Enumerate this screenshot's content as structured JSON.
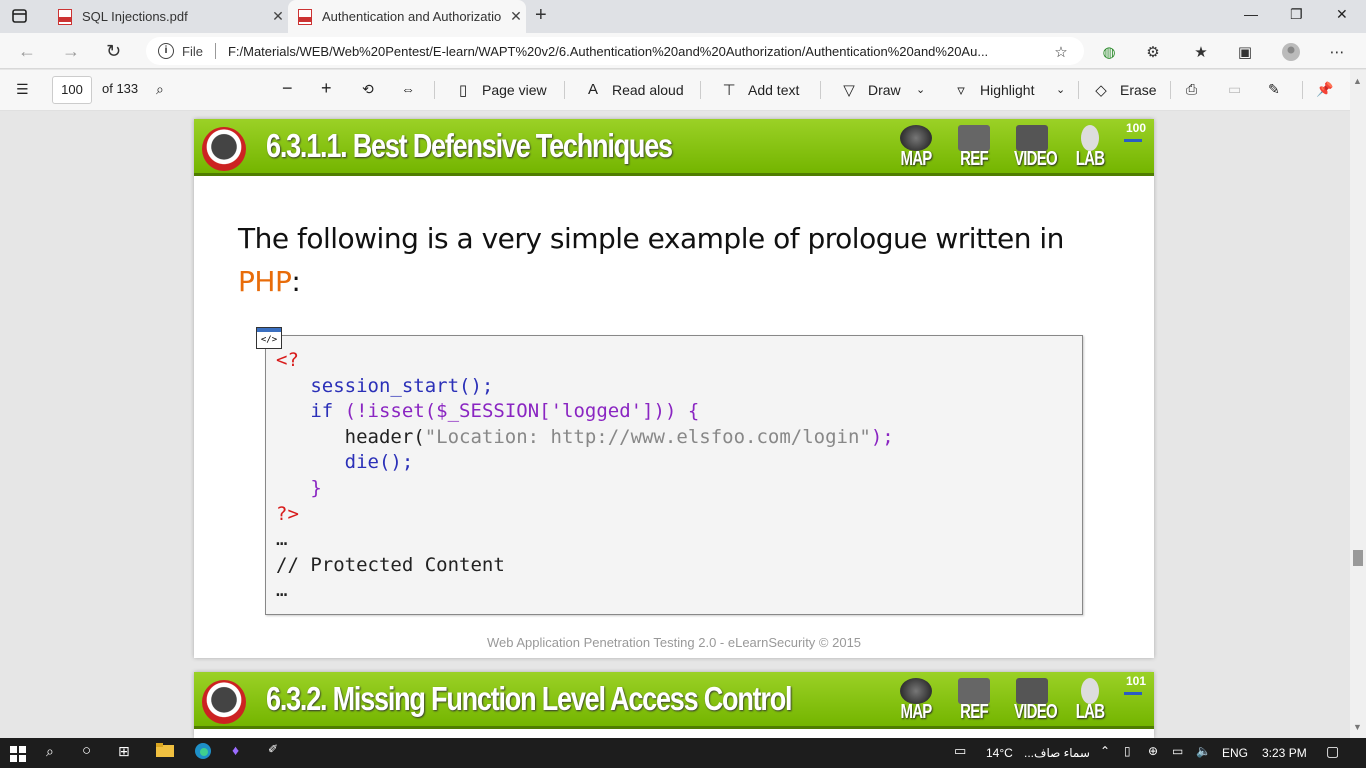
{
  "tabs": [
    {
      "label": "SQL Injections.pdf",
      "active": false
    },
    {
      "label": "Authentication and Authorizatio",
      "active": true
    }
  ],
  "address": {
    "file_label": "File",
    "url": "F:/Materials/WEB/Web%20Pentest/E-learn/WAPT%20v2/6.Authentication%20and%20Authorization/Authentication%20and%20Au..."
  },
  "pdf_toolbar": {
    "page_value": "100",
    "page_total": "of 133",
    "page_view": "Page view",
    "read_aloud": "Read aloud",
    "add_text": "Add text",
    "draw": "Draw",
    "highlight": "Highlight",
    "erase": "Erase"
  },
  "slide": {
    "title": "6.3.1.1. Best Defensive Techniques",
    "page_number": "100",
    "nav": [
      "MAP",
      "REF",
      "VIDEO",
      "LAB"
    ],
    "text_main": "The following is a very simple example of prologue written in",
    "text_highlight": "PHP",
    "text_tail": ":",
    "code_icon": "</>",
    "code": {
      "open_tag": "<?",
      "line1": "session_start();",
      "line2_kw": "if",
      "line2_rest": "(!isset($_SESSION['logged'])) {",
      "line3_fn": "header(",
      "line3_str": "\"Location: http://www.elsfoo.com/login\"",
      "line3_end": ");",
      "line4": "die();",
      "line5": "}",
      "close_tag": "?>",
      "ellipsis1": "…",
      "comment": "// Protected Content",
      "ellipsis2": "…"
    },
    "footer": "Web Application Penetration Testing 2.0 - eLearnSecurity © 2015"
  },
  "slide2": {
    "title": "6.3.2. Missing Function Level Access Control",
    "page_number": "101",
    "nav": [
      "MAP",
      "REF",
      "VIDEO",
      "LAB"
    ]
  },
  "taskbar": {
    "weather": "14°C",
    "weather_desc": "سماء صاف...",
    "lang": "ENG",
    "time": "3:23 PM"
  }
}
